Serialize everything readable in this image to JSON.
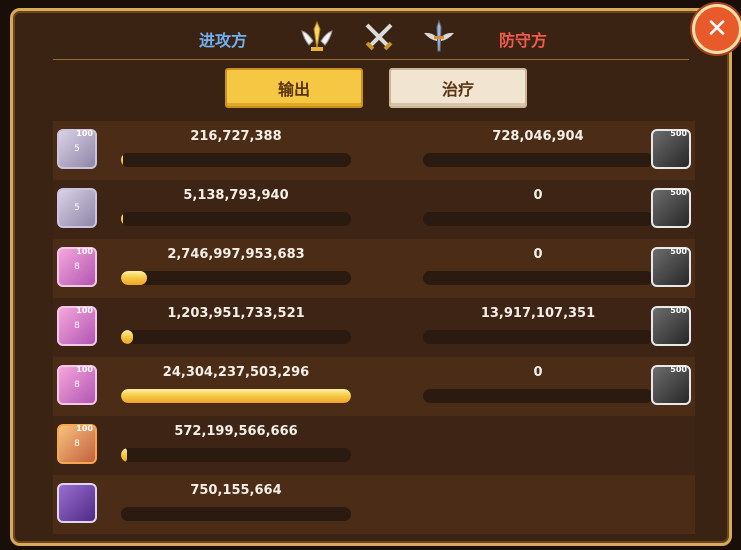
{
  "header": {
    "attacker_label": "进攻方",
    "defender_label": "防守方",
    "emblems": [
      "winged-sword-trophy-icon",
      "crossed-swords-icon",
      "winged-sword-icon"
    ]
  },
  "tabs": {
    "output_label": "输出",
    "heal_label": "治疗",
    "active": "输出"
  },
  "close_icon": "close-icon",
  "colors": {
    "attacker": "#6fb0f0",
    "defender": "#ee5b4d",
    "active_tab": "#f6c743",
    "bar_fill": "#f5c842"
  },
  "attackers": [
    {
      "value": "216,727,388",
      "fill": 0.009,
      "avatar_level": "100",
      "avatar_stars": "5"
    },
    {
      "value": "5,138,793,940",
      "fill": 0.009,
      "avatar_level": "",
      "avatar_stars": "5"
    },
    {
      "value": "2,746,997,953,683",
      "fill": 0.113,
      "avatar_level": "100",
      "avatar_stars": "8"
    },
    {
      "value": "1,203,951,733,521",
      "fill": 0.05,
      "avatar_level": "100",
      "avatar_stars": "8"
    },
    {
      "value": "24,304,237,503,296",
      "fill": 1.0,
      "avatar_level": "100",
      "avatar_stars": "8"
    },
    {
      "value": "572,199,566,666",
      "fill": 0.024,
      "avatar_level": "100",
      "avatar_stars": "8"
    },
    {
      "value": "750,155,664",
      "fill": 0.0,
      "avatar_level": "",
      "avatar_stars": ""
    }
  ],
  "defenders": [
    {
      "value": "728,046,904",
      "fill": 0.0,
      "avatar_level": "500"
    },
    {
      "value": "0",
      "fill": 0.0,
      "avatar_level": "500"
    },
    {
      "value": "0",
      "fill": 0.0,
      "avatar_level": "500"
    },
    {
      "value": "13,917,107,351",
      "fill": 0.0,
      "avatar_level": "500"
    },
    {
      "value": "0",
      "fill": 0.0,
      "avatar_level": "500"
    }
  ]
}
